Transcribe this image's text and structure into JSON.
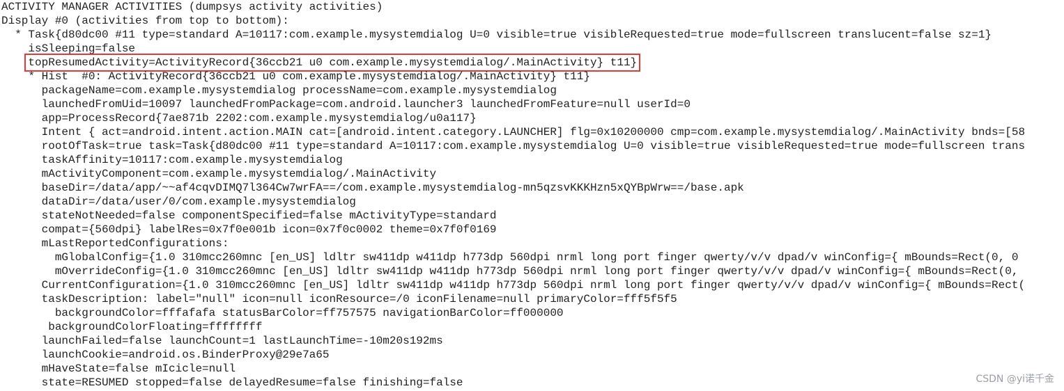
{
  "lines": [
    "ACTIVITY MANAGER ACTIVITIES (dumpsys activity activities)",
    "Display #0 (activities from top to bottom):",
    "  * Task{d80dc00 #11 type=standard A=10117:com.example.mysystemdialog U=0 visible=true visibleRequested=true mode=fullscreen translucent=false sz=1}",
    "    isSleeping=false",
    "    topResumedActivity=ActivityRecord{36ccb21 u0 com.example.mysystemdialog/.MainActivity} t11}",
    "    * Hist  #0: ActivityRecord{36ccb21 u0 com.example.mysystemdialog/.MainActivity} t11}",
    "      packageName=com.example.mysystemdialog processName=com.example.mysystemdialog",
    "      launchedFromUid=10097 launchedFromPackage=com.android.launcher3 launchedFromFeature=null userId=0",
    "      app=ProcessRecord{7ae871b 2202:com.example.mysystemdialog/u0a117}",
    "      Intent { act=android.intent.action.MAIN cat=[android.intent.category.LAUNCHER] flg=0x10200000 cmp=com.example.mysystemdialog/.MainActivity bnds=[58",
    "      rootOfTask=true task=Task{d80dc00 #11 type=standard A=10117:com.example.mysystemdialog U=0 visible=true visibleRequested=true mode=fullscreen trans",
    "      taskAffinity=10117:com.example.mysystemdialog",
    "      mActivityComponent=com.example.mysystemdialog/.MainActivity",
    "      baseDir=/data/app/~~af4cqvDIMQ7l364Cw7wrFA==/com.example.mysystemdialog-mn5qzsvKKKHzn5xQYBpWrw==/base.apk",
    "      dataDir=/data/user/0/com.example.mysystemdialog",
    "      stateNotNeeded=false componentSpecified=false mActivityType=standard",
    "      compat={560dpi} labelRes=0x7f0e001b icon=0x7f0c0002 theme=0x7f0f0169",
    "      mLastReportedConfigurations:",
    "        mGlobalConfig={1.0 310mcc260mnc [en_US] ldltr sw411dp w411dp h773dp 560dpi nrml long port finger qwerty/v/v dpad/v winConfig={ mBounds=Rect(0, 0",
    "        mOverrideConfig={1.0 310mcc260mnc [en_US] ldltr sw411dp w411dp h773dp 560dpi nrml long port finger qwerty/v/v dpad/v winConfig={ mBounds=Rect(0,",
    "      CurrentConfiguration={1.0 310mcc260mnc [en_US] ldltr sw411dp w411dp h773dp 560dpi nrml long port finger qwerty/v/v dpad/v winConfig={ mBounds=Rect(",
    "      taskDescription: label=\"null\" icon=null iconResource=/0 iconFilename=null primaryColor=fff5f5f5",
    "        backgroundColor=fffafafa statusBarColor=ff757575 navigationBarColor=ff000000",
    "       backgroundColorFloating=ffffffff",
    "      launchFailed=false launchCount=1 lastLaunchTime=-10m20s192ms",
    "      launchCookie=android.os.BinderProxy@29e7a65",
    "      mHaveState=false mIcicle=null",
    "      state=RESUMED stopped=false delayedResume=false finishing=false"
  ],
  "highlight": {
    "indent": "    ",
    "text": "topResumedActivity=ActivityRecord{36ccb21 u0 com.example.mysystemdialog/.MainActivity} t11}",
    "color": "#e53935"
  },
  "watermark": "CSDN @yi诺千金",
  "colors": {
    "text": "#222222",
    "background": "#ffffff",
    "watermark": "#9aa0a6"
  }
}
